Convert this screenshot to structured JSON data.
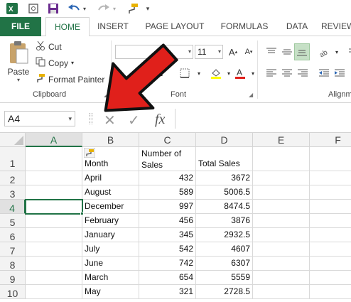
{
  "qat": {
    "save": "save-icon",
    "undo": "undo-icon",
    "redo": "redo-icon",
    "painter": "format-painter-icon"
  },
  "tabs": [
    {
      "label": "FILE"
    },
    {
      "label": "HOME"
    },
    {
      "label": "INSERT"
    },
    {
      "label": "PAGE LAYOUT"
    },
    {
      "label": "FORMULAS"
    },
    {
      "label": "DATA"
    },
    {
      "label": "REVIEW"
    }
  ],
  "ribbon": {
    "clipboard": {
      "paste": "Paste",
      "cut": "Cut",
      "copy": "Copy",
      "format_painter": "Format Painter",
      "label": "Clipboard"
    },
    "font": {
      "font_name": "",
      "font_size": "11",
      "label": "Font"
    },
    "alignment": {
      "label": "Alignm"
    }
  },
  "formula_bar": {
    "name_box": "A4",
    "cancel": "✕",
    "enter": "✓",
    "fx": "fx"
  },
  "sheet": {
    "columns": [
      "A",
      "B",
      "C",
      "D",
      "E",
      "F"
    ],
    "rows": [
      "1",
      "2",
      "3",
      "4",
      "5",
      "6",
      "7",
      "8",
      "9",
      "10"
    ],
    "headers": {
      "month": "Month",
      "number_of_sales_line1": "Number of",
      "number_of_sales_line2": "Sales",
      "total_sales": "Total Sales"
    },
    "data": [
      {
        "month": "April",
        "num": "432",
        "total": "3672"
      },
      {
        "month": "August",
        "num": "589",
        "total": "5006.5"
      },
      {
        "month": "December",
        "num": "997",
        "total": "8474.5"
      },
      {
        "month": "February",
        "num": "456",
        "total": "3876"
      },
      {
        "month": "January",
        "num": "345",
        "total": "2932.5"
      },
      {
        "month": "July",
        "num": "542",
        "total": "4607"
      },
      {
        "month": "June",
        "num": "742",
        "total": "6307"
      },
      {
        "month": "March",
        "num": "654",
        "total": "5559"
      },
      {
        "month": "May",
        "num": "321",
        "total": "2728.5"
      }
    ]
  },
  "colors": {
    "accent": "#217346",
    "arrow_fill": "#e0201b"
  }
}
